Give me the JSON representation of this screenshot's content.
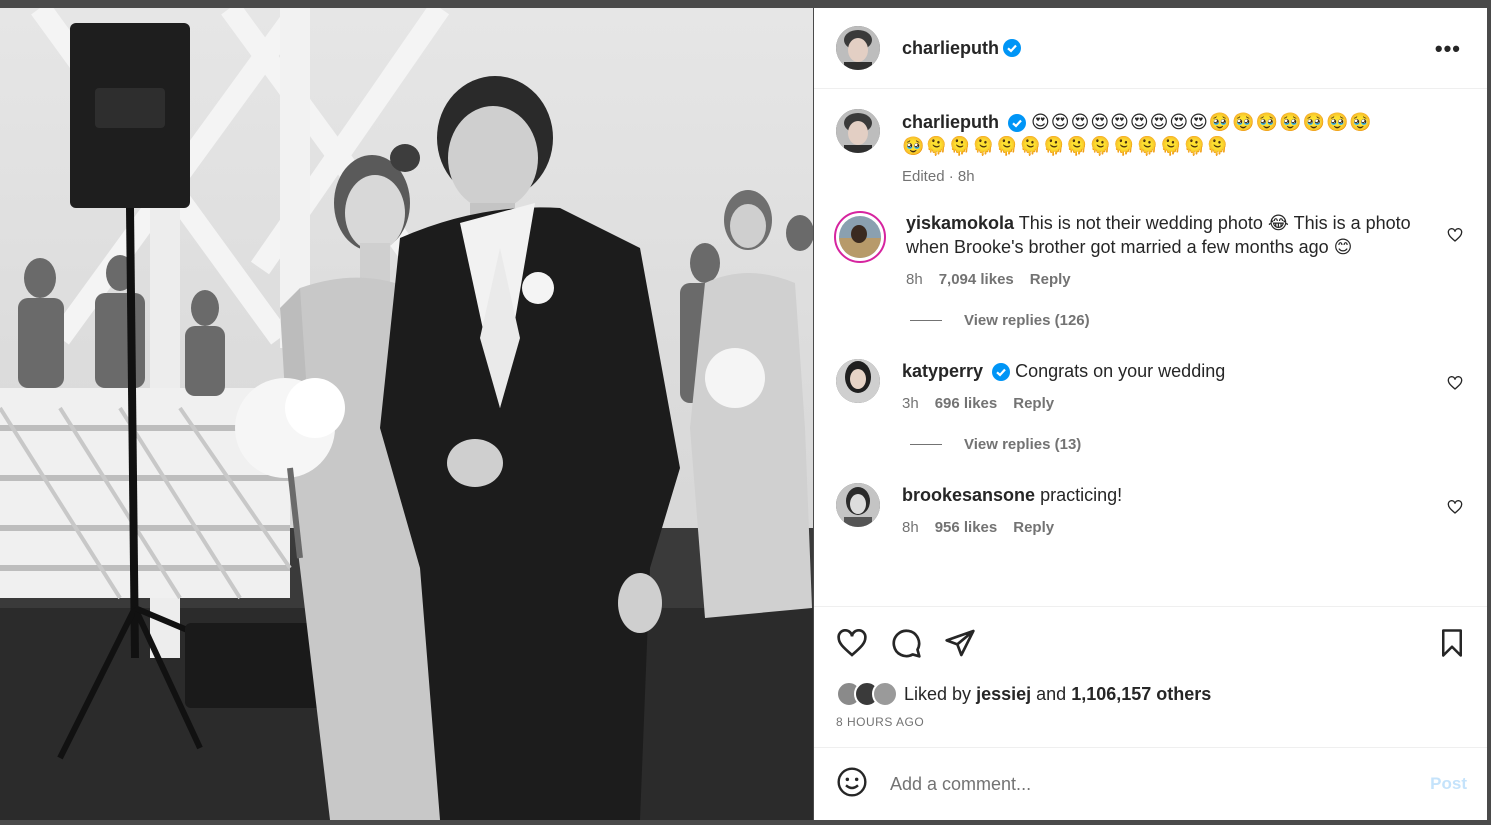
{
  "post": {
    "username": "charlieputh",
    "more_icon": "more-horizontal-icon"
  },
  "caption": {
    "username": "charlieputh",
    "emoji_line1": "😍😍😍😍😍😍😍😍😍🥹🥹🥹🥹🥹🥹🥹",
    "emoji_line2": "🥹🫠🫠🫠🫠🫠🫠🫠🫠🫠🫠🫠🫠🫠",
    "edited": "Edited",
    "time": "8h"
  },
  "comments": [
    {
      "username": "yiskamokola",
      "text": "This is not their wedding photo 😂 This is a photo when Brooke's brother got married a few months ago 😊",
      "time": "8h",
      "likes": "7,094 likes",
      "reply": "Reply",
      "view_replies": "View replies (126)"
    },
    {
      "username": "katyperry",
      "text": "Congrats on your wedding",
      "time": "3h",
      "likes": "696 likes",
      "reply": "Reply",
      "view_replies": "View replies (13)"
    },
    {
      "username": "brookesansone",
      "text": "practicing!",
      "time": "8h",
      "likes": "956 likes",
      "reply": "Reply"
    }
  ],
  "actions": {
    "liked_by_prefix": "Liked by",
    "liked_by_user": "jessiej",
    "and": "and",
    "others": "1,106,157 others",
    "timestamp": "8 HOURS AGO"
  },
  "composer": {
    "placeholder": "Add a comment...",
    "post_label": "Post"
  },
  "colors": {
    "verified": "#0095f6",
    "post_disabled": "#c5e3fb",
    "secondary_text": "#737373"
  }
}
